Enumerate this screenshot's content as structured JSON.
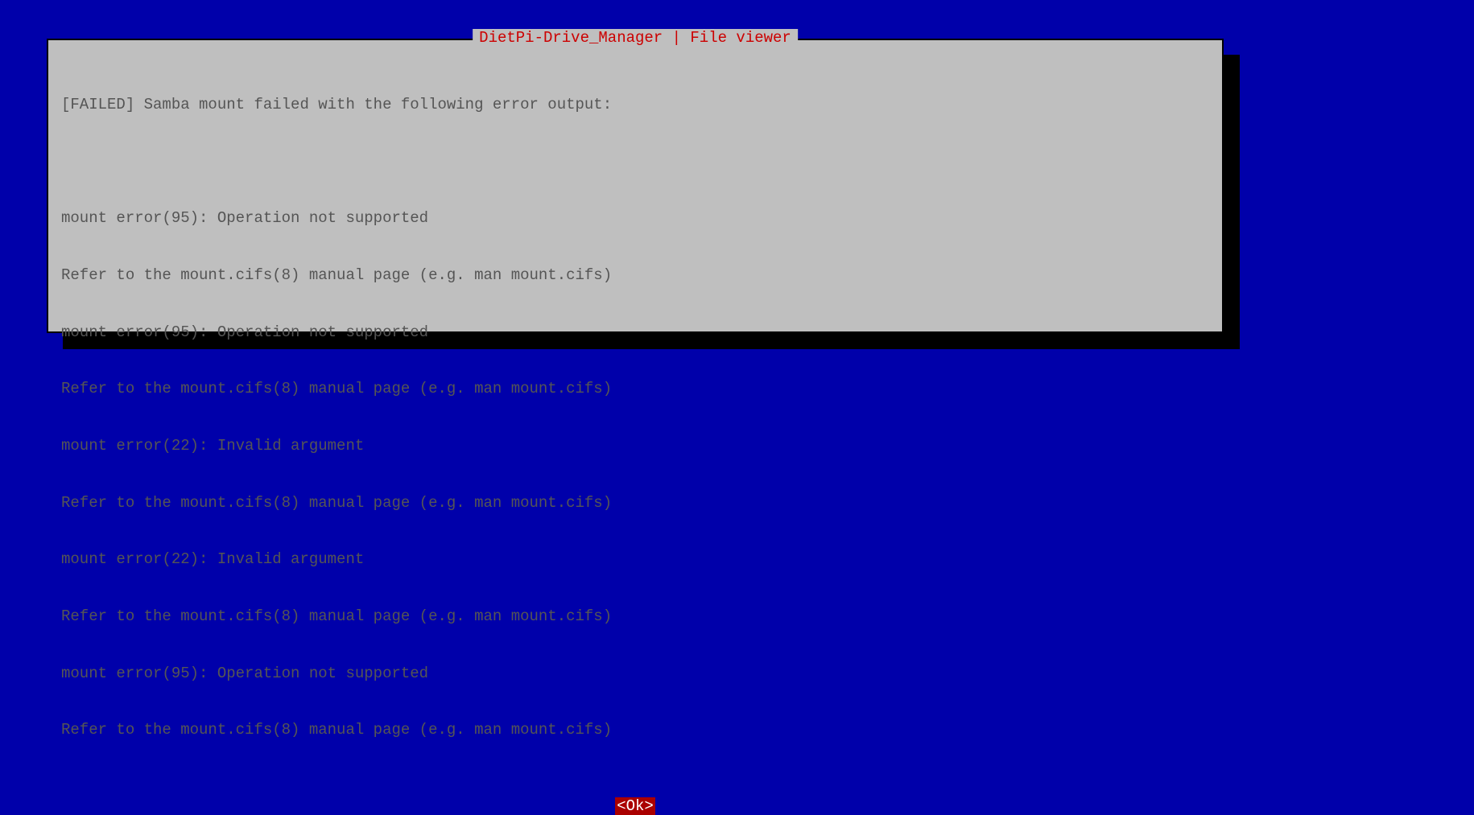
{
  "dialog": {
    "title": "DietPi-Drive_Manager | File viewer",
    "status_line": "[FAILED] Samba mount failed with the following error output:",
    "messages": [
      "mount error(95): Operation not supported",
      "Refer to the mount.cifs(8) manual page (e.g. man mount.cifs)",
      "mount error(95): Operation not supported",
      "Refer to the mount.cifs(8) manual page (e.g. man mount.cifs)",
      "mount error(22): Invalid argument",
      "Refer to the mount.cifs(8) manual page (e.g. man mount.cifs)",
      "mount error(22): Invalid argument",
      "Refer to the mount.cifs(8) manual page (e.g. man mount.cifs)",
      "mount error(95): Operation not supported",
      "Refer to the mount.cifs(8) manual page (e.g. man mount.cifs)"
    ],
    "ok_label": "<Ok>"
  }
}
